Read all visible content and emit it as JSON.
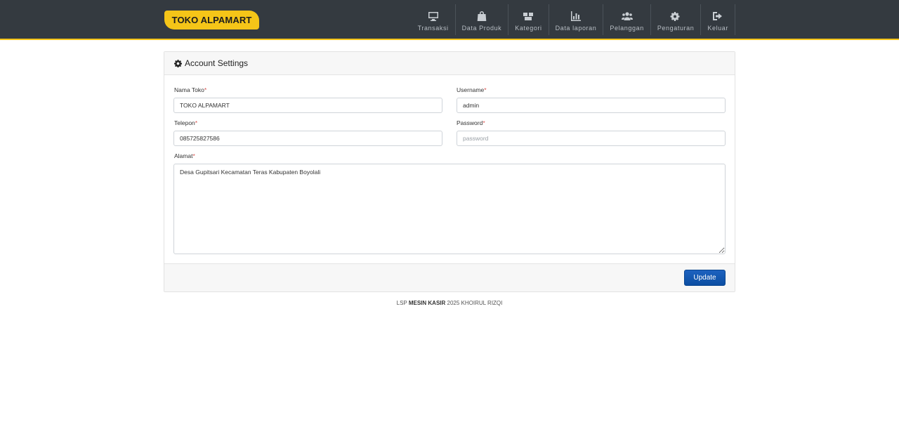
{
  "brand": {
    "name": "TOKO ALPAMART",
    "color": "#f5c518"
  },
  "nav": {
    "items": [
      {
        "label": "Transaksi",
        "icon": "monitor-icon"
      },
      {
        "label": "Data Produk",
        "icon": "shopping-bag-icon"
      },
      {
        "label": "Kategori",
        "icon": "boxes-icon"
      },
      {
        "label": "Data laporan",
        "icon": "bar-chart-icon"
      },
      {
        "label": "Pelanggan",
        "icon": "users-icon"
      },
      {
        "label": "Pengaturan",
        "icon": "cogs-icon"
      },
      {
        "label": "Keluar",
        "icon": "sign-out-icon"
      }
    ]
  },
  "settings": {
    "title": "Account Settings",
    "nama_toko": {
      "label": "Nama Toko",
      "required_mark": "*",
      "value": "TOKO ALPAMART"
    },
    "username": {
      "label": "Username",
      "required_mark": "*",
      "value": "admin"
    },
    "telepon": {
      "label": "Telepon",
      "required_mark": "*",
      "value": "085725827586"
    },
    "password": {
      "label": "Password",
      "required_mark": "*",
      "value": "",
      "placeholder": "password"
    },
    "alamat": {
      "label": "Alamat",
      "required_mark": "*",
      "value": "Desa Gupitsari Kecamatan Teras Kabupaten Boyolali"
    },
    "update_label": "Update"
  },
  "footer": {
    "prefix": "LSP",
    "bold": "MESIN KASIR",
    "suffix": "2025 KHOIRUL RIZQI"
  }
}
